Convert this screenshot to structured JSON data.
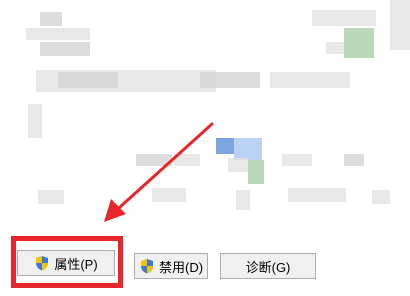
{
  "buttons": {
    "properties_label": "属性",
    "properties_key": "(P)",
    "disable_label": "禁用",
    "disable_key": "(D)",
    "diagnose_label": "诊断",
    "diagnose_key": "(G)"
  },
  "colors": {
    "highlight": "#e8262a",
    "arrow": "#e8262a"
  },
  "icons": {
    "properties": "uac-shield-icon",
    "disable": "uac-shield-icon"
  }
}
